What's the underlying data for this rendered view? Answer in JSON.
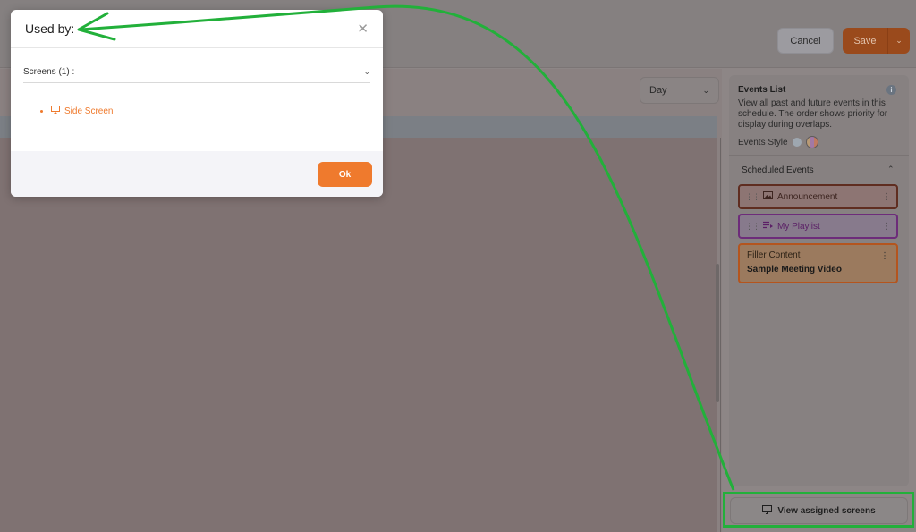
{
  "header": {
    "cancel_label": "Cancel",
    "save_label": "Save"
  },
  "calendar": {
    "view_selected": "Day"
  },
  "events_panel": {
    "title": "Events List",
    "description": "View all past and future events in this schedule. The order shows priority for display during overlaps.",
    "style_label": "Events Style",
    "scheduled_title": "Scheduled Events",
    "events": [
      {
        "label": "Announcement",
        "icon": "image-icon",
        "border_color": "#5f2d20"
      },
      {
        "label": "My Playlist",
        "icon": "playlist-icon",
        "border_color": "#6d2c7a"
      }
    ],
    "filler": {
      "title": "Filler Content",
      "subtitle": "Sample Meeting Video",
      "border_color": "#b4551e"
    },
    "view_assigned_label": "View assigned screens"
  },
  "modal": {
    "title": "Used by:",
    "section_label": "Screens (1) :",
    "screens": [
      "Side Screen"
    ],
    "ok_label": "Ok"
  },
  "colors": {
    "accent": "#ef7a2d",
    "annotation": "#22b03a"
  }
}
